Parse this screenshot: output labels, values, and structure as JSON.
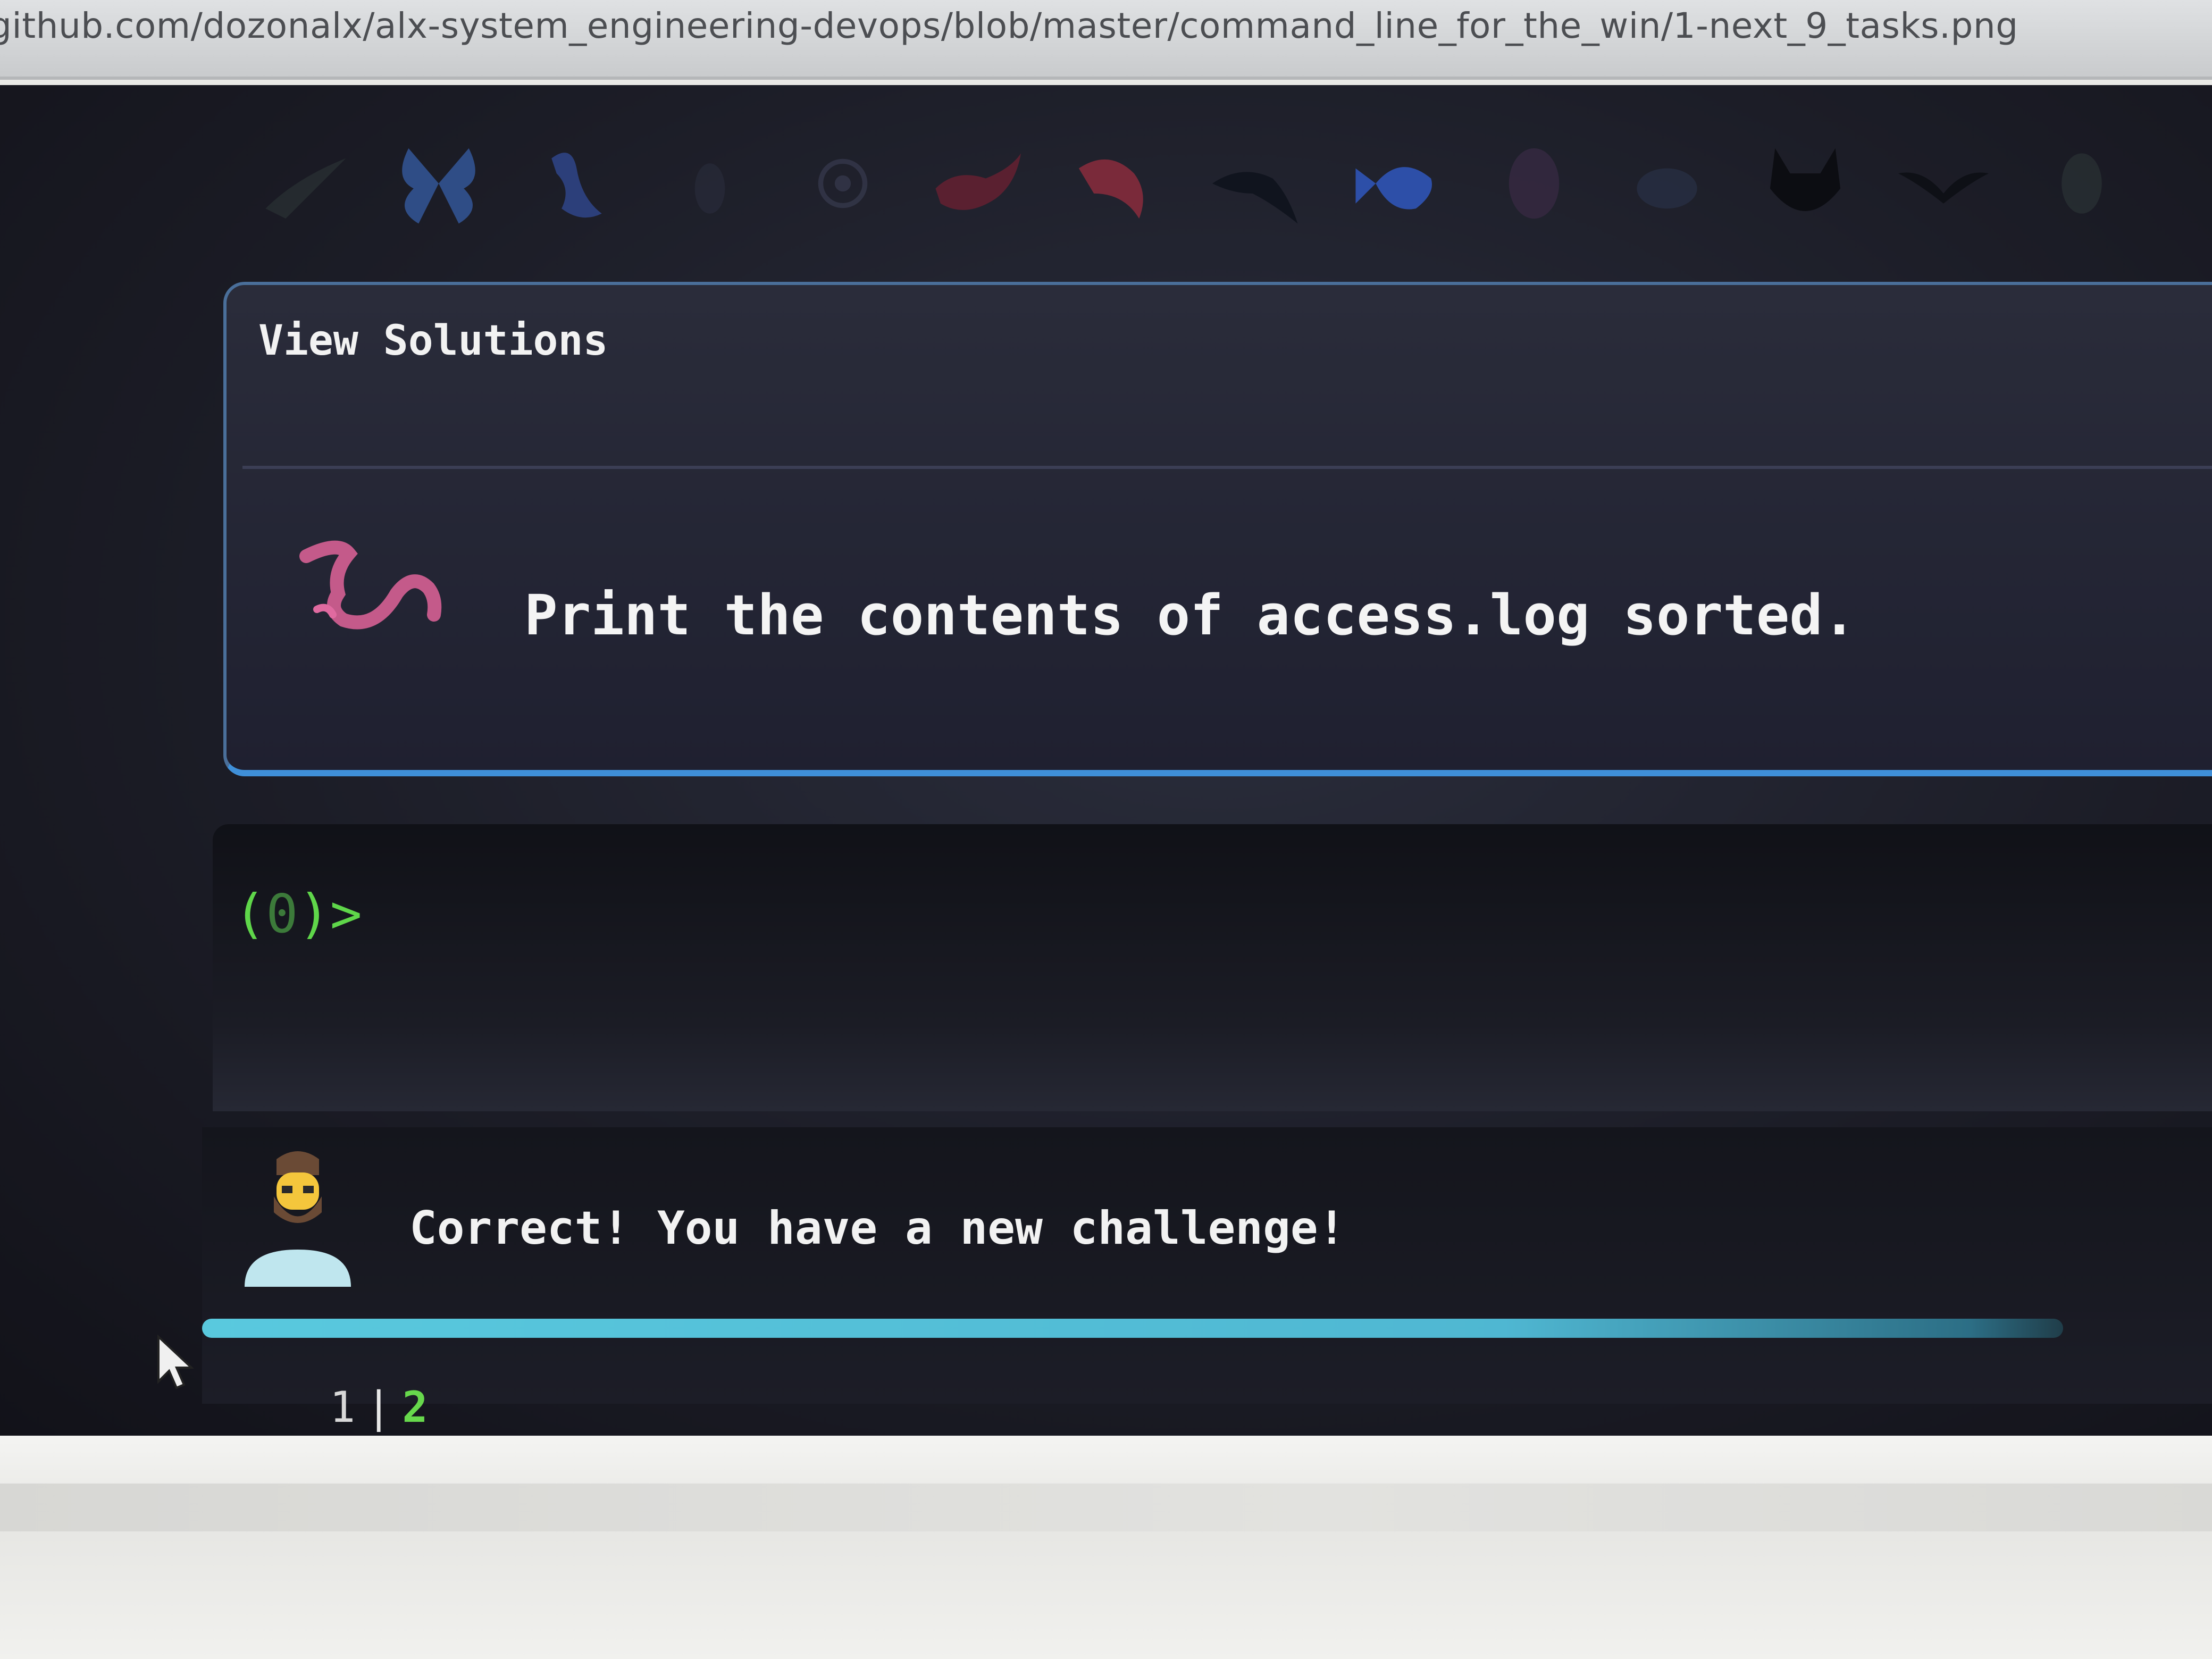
{
  "browser": {
    "url": "github.com/dozonalx/alx-system_engineering-devops/blob/master/command_line_for_the_win/1-next_9_tasks.png"
  },
  "icons": [
    "bird-icon",
    "butterfly-icon",
    "seahorse-icon",
    "bug-icon",
    "jellyfish-icon",
    "whale-icon",
    "fish-icon",
    "dolphin-icon",
    "tropical-fish-icon",
    "shell-icon",
    "crab-icon",
    "raccoon-icon",
    "bat-icon",
    "turtle-icon"
  ],
  "task": {
    "header": "View Solutions",
    "text": "Print the contents of access.log sorted."
  },
  "terminal": {
    "prompt_open": "(",
    "prompt_count": "0",
    "prompt_close": ")>"
  },
  "message": {
    "text": "Correct! You have a new challenge!"
  },
  "progress": {
    "fraction": 1.0
  },
  "pager": {
    "previous": "1",
    "separator": "|",
    "current": "2"
  },
  "colors": {
    "accent": "#3f8fd8",
    "prompt_green": "#5fd64a",
    "progress": "#59c9de"
  }
}
